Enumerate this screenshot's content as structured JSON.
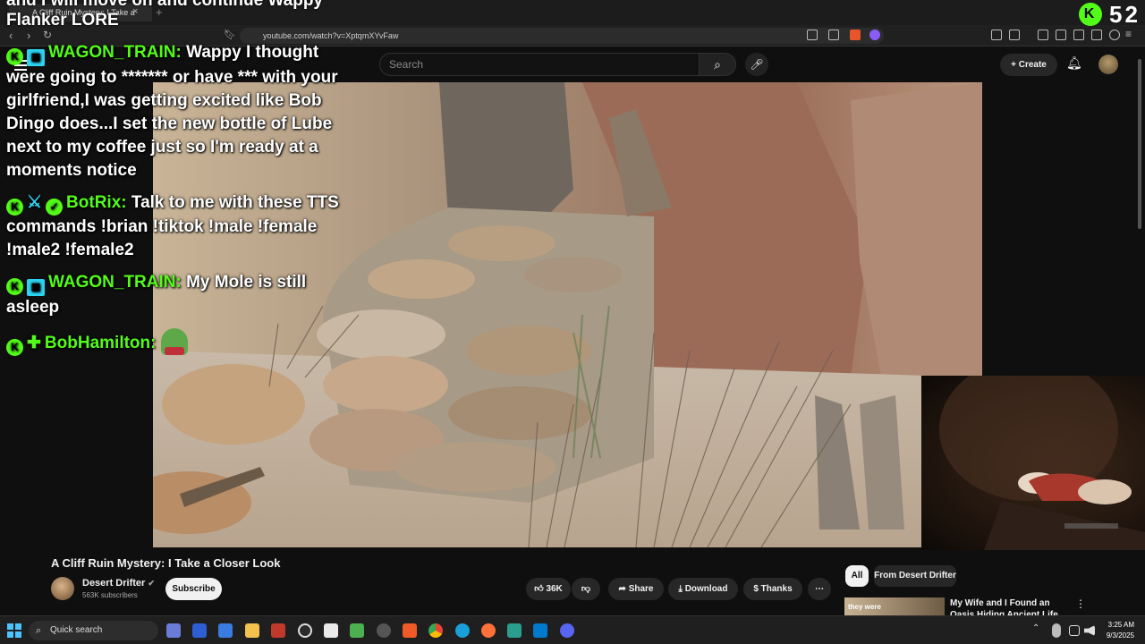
{
  "browser": {
    "tab_title": "A Cliff Ruin Mystery: I Take a",
    "tab_close": "×",
    "new_tab": "+",
    "url": "youtube.com/watch?v=XptqmXYvFaw"
  },
  "youtube": {
    "search_placeholder": "Search",
    "create_label": "+ Create",
    "video_title": "A Cliff Ruin Mystery: I Take a Closer Look",
    "channel_name": "Desert Drifter",
    "channel_subs": "563K subscribers",
    "subscribe_label": "Subscribe",
    "likes": "36K",
    "share_label": "Share",
    "download_label": "Download",
    "thanks_label": "Thanks",
    "more_label": "⋯",
    "filters": [
      "All",
      "From Desert Drifter"
    ],
    "rec_title": "My Wife and I Found an Oasis Hiding Ancient Life",
    "rec_thumb_text": "they were",
    "rec_more": "⋮"
  },
  "overlay": {
    "top_text_1": "and I will move on and continue Wappy",
    "top_text_2": "Flanker LORE",
    "viewer_count": "52",
    "kick_badge": "K",
    "messages": [
      {
        "user": "WAGON_TRAIN:",
        "text": " Wappy I thought were going to ******* or have *** with your girlfriend,I was getting excited like Bob Dingo does...I set the new bottle of Lube next to my coffee just so I'm ready at a moments notice"
      },
      {
        "user": "BotRix:",
        "text": " Talk to me with these TTS commands !brian !tiktok !male !female !male2 !female2"
      },
      {
        "user": "WAGON_TRAIN:",
        "text": " My Mole is still asleep"
      },
      {
        "user": "BobHamilton:",
        "text": ""
      }
    ]
  },
  "taskbar": {
    "search_label": "Quick search",
    "time": "3:25 AM",
    "date": "9/3/2025"
  },
  "colors": {
    "kick_green": "#53fc18",
    "yt_bg": "#0f0f0f"
  }
}
